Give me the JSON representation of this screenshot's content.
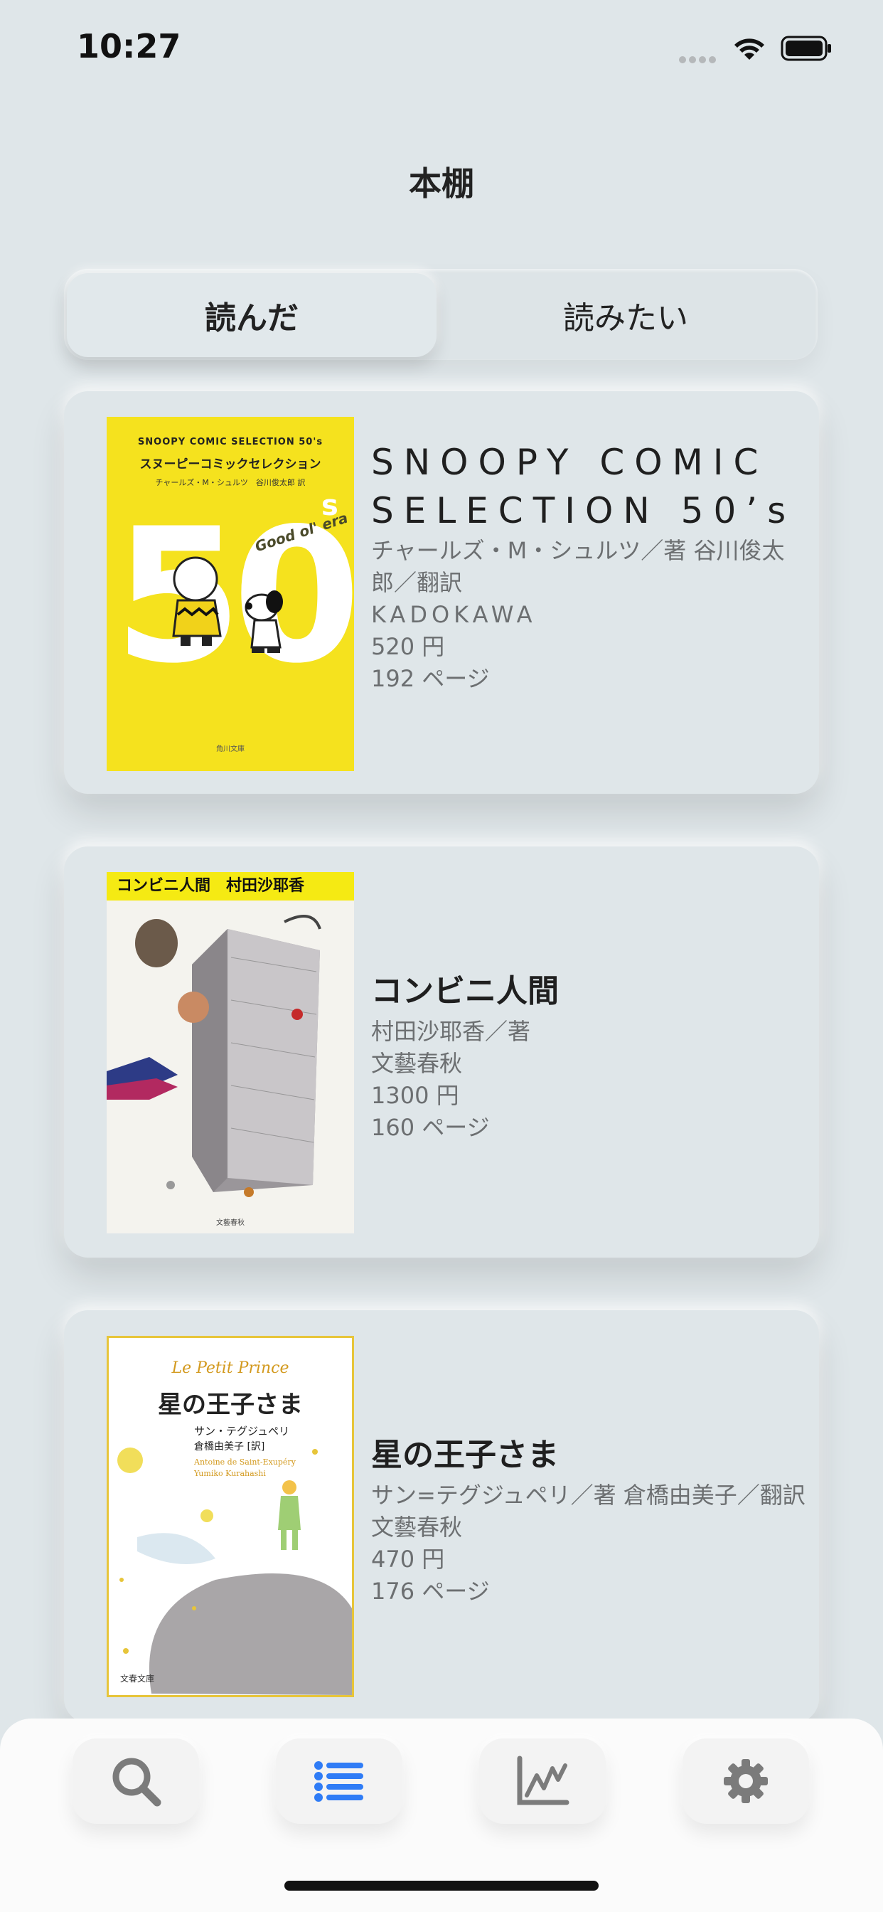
{
  "status": {
    "time": "10:27"
  },
  "header": {
    "title": "本棚"
  },
  "segments": {
    "read": "読んだ",
    "want": "読みたい"
  },
  "books": [
    {
      "title": "SNOOPY COMIC SELECTION 50’s",
      "author": "チャールズ・M・シュルツ／著 谷川俊太郎／翻訳",
      "publisher": "KADOKAWA",
      "price": "520 円",
      "pages": "192 ページ",
      "cover": {
        "top_line": "SNOOPY COMIC SELECTION 50's",
        "jp_title": "スヌーピーコミックセレクション",
        "credit": "チャールズ・M・シュルツ　谷川俊太郎 訳",
        "big": "50",
        "sup": "s",
        "era": "Good ol' era",
        "imprint": "角川文庫"
      }
    },
    {
      "title": "コンビニ人間",
      "author": "村田沙耶香／著",
      "publisher": "文藝春秋",
      "price": "1300 円",
      "pages": "160 ページ",
      "cover": {
        "band": "コンビニ人間　村田沙耶香",
        "imprint": "文藝春秋"
      }
    },
    {
      "title": "星の王子さま",
      "author": "サン=テグジュペリ／著 倉橋由美子／翻訳",
      "publisher": "文藝春秋",
      "price": "470 円",
      "pages": "176 ページ",
      "cover": {
        "script": "Le Petit Prince",
        "jp_title": "星の王子さま",
        "author_jp": "サン・テグジュペリ",
        "translator": "倉橋由美子 [訳]",
        "author_en": "Antoine de Saint-Exupéry",
        "translator_en": "Yumiko Kurahashi",
        "imprint": "文春文庫"
      }
    }
  ],
  "tabbar": {
    "items": [
      {
        "icon": "search-icon",
        "active": false
      },
      {
        "icon": "list-icon",
        "active": true
      },
      {
        "icon": "chart-icon",
        "active": false
      },
      {
        "icon": "gear-icon",
        "active": false
      }
    ],
    "active_color": "#2f7cf6",
    "inactive_color": "#7b7b7b"
  }
}
